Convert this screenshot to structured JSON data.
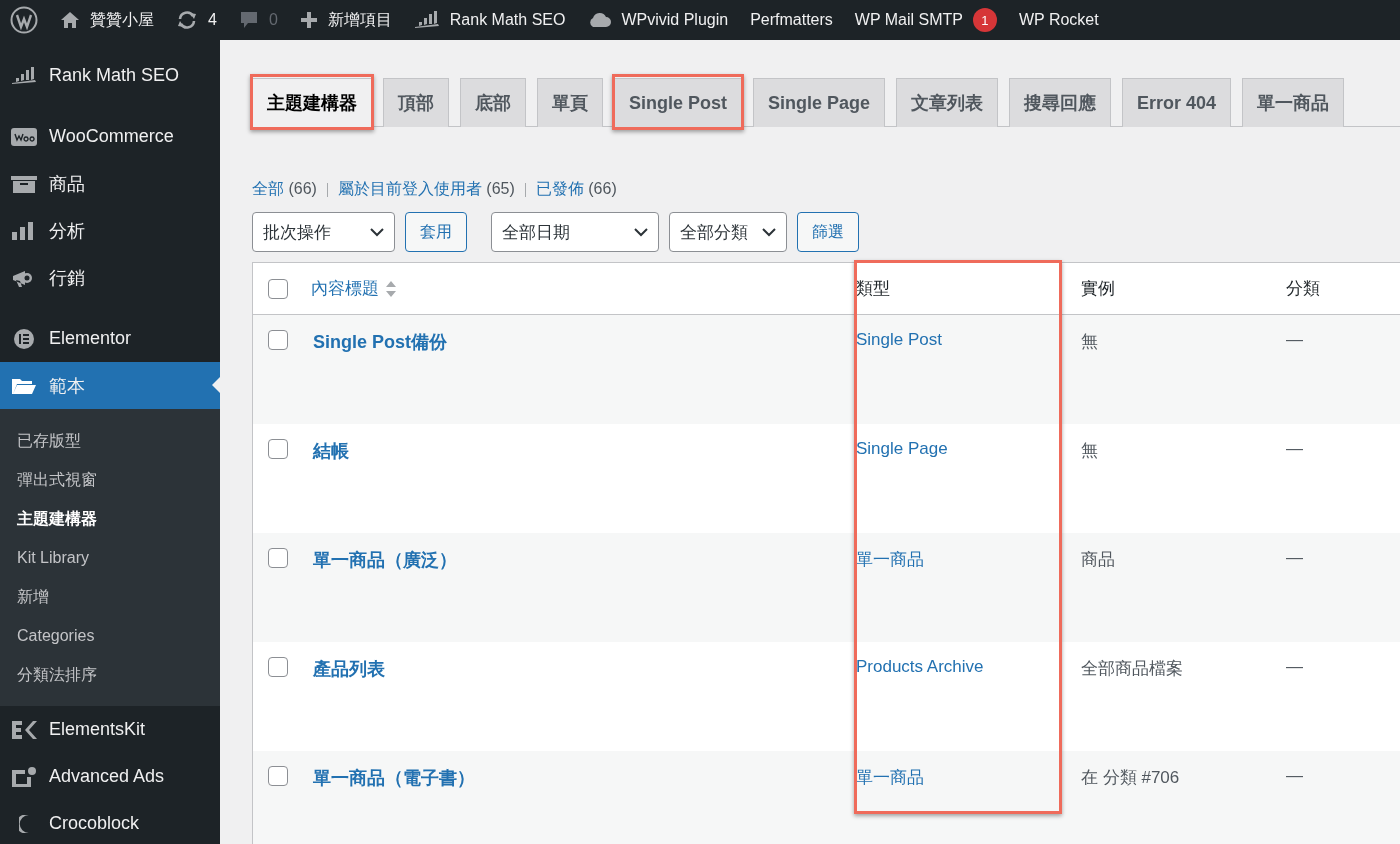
{
  "topbar": {
    "items": [
      {
        "kind": "logo"
      },
      {
        "kind": "site",
        "label": "贊贊小屋"
      },
      {
        "kind": "updates",
        "label": "4"
      },
      {
        "kind": "comments",
        "label": "0"
      },
      {
        "kind": "new",
        "label": "新增項目"
      },
      {
        "kind": "chart",
        "label": "Rank Math SEO"
      },
      {
        "kind": "cloud",
        "label": "WPvivid Plugin"
      },
      {
        "kind": "text",
        "label": "Perfmatters"
      },
      {
        "kind": "text",
        "label": "WP Mail SMTP",
        "badge": "1"
      },
      {
        "kind": "text",
        "label": "WP Rocket"
      }
    ]
  },
  "sidebar": {
    "groups": [
      {
        "items": [
          {
            "label": "Rank Math SEO",
            "selected": false
          }
        ]
      },
      {
        "items": [
          {
            "label": "WooCommerce",
            "selected": false
          },
          {
            "label": "商品",
            "selected": false
          },
          {
            "label": "分析",
            "selected": false
          },
          {
            "label": "行銷",
            "selected": false
          }
        ]
      },
      {
        "items": [
          {
            "label": "Elementor",
            "selected": false
          },
          {
            "label": "範本",
            "selected": true,
            "children": [
              {
                "label": "已存版型",
                "selected": false
              },
              {
                "label": "彈出式視窗",
                "selected": false
              },
              {
                "label": "主題建構器",
                "selected": true
              },
              {
                "label": "Kit Library",
                "selected": false
              },
              {
                "label": "新增",
                "selected": false
              },
              {
                "label": "Categories",
                "selected": false
              },
              {
                "label": "分類法排序",
                "selected": false
              }
            ]
          },
          {
            "label": "ElementsKit",
            "selected": false
          },
          {
            "label": "Advanced Ads",
            "selected": false
          },
          {
            "label": "Crocoblock",
            "selected": false
          }
        ]
      }
    ]
  },
  "tabs": [
    {
      "label": "主題建構器",
      "selected": true,
      "highlighted": true
    },
    {
      "label": "頂部",
      "selected": false,
      "highlighted": false
    },
    {
      "label": "底部",
      "selected": false,
      "highlighted": false
    },
    {
      "label": "單頁",
      "selected": false,
      "highlighted": false
    },
    {
      "label": "Single Post",
      "selected": false,
      "highlighted": true
    },
    {
      "label": "Single Page",
      "selected": false,
      "highlighted": false
    },
    {
      "label": "文章列表",
      "selected": false,
      "highlighted": false
    },
    {
      "label": "搜尋回應",
      "selected": false,
      "highlighted": false
    },
    {
      "label": "Error 404",
      "selected": false,
      "highlighted": false
    },
    {
      "label": "單一商品",
      "selected": false,
      "highlighted": false
    }
  ],
  "views": [
    {
      "label": "全部",
      "count": "(66)"
    },
    {
      "label": "屬於目前登入使用者",
      "count": "(65)"
    },
    {
      "label": "已發佈",
      "count": "(66)"
    }
  ],
  "filters": [
    {
      "kind": "select",
      "label": "批次操作"
    },
    {
      "kind": "button",
      "label": "套用"
    },
    {
      "kind": "select",
      "label": "全部日期"
    },
    {
      "kind": "select",
      "label": "全部分類"
    },
    {
      "kind": "button",
      "label": "篩選"
    }
  ],
  "table": {
    "select_all_checked": false,
    "columns": [
      {
        "label": "內容標題",
        "sortable": true,
        "highlighted": false
      },
      {
        "label": "類型",
        "sortable": false,
        "highlighted": true
      },
      {
        "label": "實例",
        "sortable": false,
        "highlighted": false
      },
      {
        "label": "分類",
        "sortable": false,
        "highlighted": false
      }
    ],
    "rows": [
      {
        "checked": false,
        "title": "Single Post備份",
        "type": "Single Post",
        "instance": "無",
        "category": "—"
      },
      {
        "checked": false,
        "title": "結帳",
        "type": "Single Page",
        "instance": "無",
        "category": "—"
      },
      {
        "checked": false,
        "title": "單一商品（廣泛）",
        "type": "單一商品",
        "instance": "商品",
        "category": "—"
      },
      {
        "checked": false,
        "title": "產品列表",
        "type": "Products Archive",
        "instance": "全部商品檔案",
        "category": "—"
      },
      {
        "checked": false,
        "title": "單一商品（電子書）",
        "type": "單一商品",
        "instance": "在 分類 #706",
        "category": "—"
      }
    ]
  }
}
